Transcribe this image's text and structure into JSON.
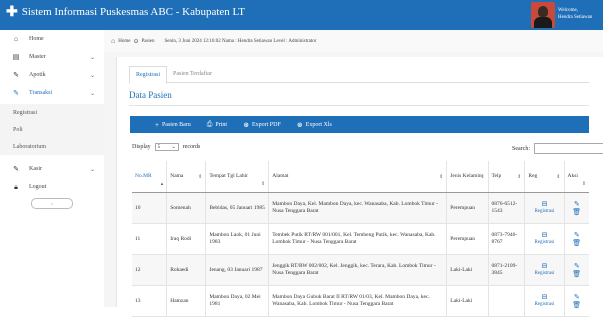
{
  "header": {
    "app_title": "Sistem Informasi Puskesmas ABC - Kabupaten LT",
    "welcome": "Welcome,",
    "user_name": "Hendra Setiawan"
  },
  "sidebar": {
    "items": [
      {
        "label": "Home",
        "icon": "home-icon"
      },
      {
        "label": "Master",
        "icon": "table-icon"
      },
      {
        "label": "Apotik",
        "icon": "edit-icon"
      },
      {
        "label": "Transaksi",
        "icon": "edit-icon"
      },
      {
        "label": "Kasir",
        "icon": "edit-icon"
      },
      {
        "label": "Logout",
        "icon": "lock-icon"
      }
    ],
    "sub_items": [
      "Registrasi",
      "Poli",
      "Laboratorium"
    ],
    "collapse_label": "‹"
  },
  "breadcrumb": {
    "home": "Home",
    "current": "Pasien",
    "status": "Senin, 3 Juni 2024 12:16:02 Nama : Hendra Setiawan Level : Administrator"
  },
  "tabs": [
    {
      "label": "Registrasi"
    },
    {
      "label": "Pasien Terdaftar"
    }
  ],
  "page_title": "Data Pasien",
  "toolbar": {
    "new_label": "Pasien Baru",
    "print_label": "Print",
    "pdf_label": "Export PDF",
    "xls_label": "Export Xls"
  },
  "table_controls": {
    "display_label": "Display",
    "display_value": "5",
    "records_label": "records",
    "search_label": "Search:"
  },
  "table": {
    "columns": [
      "No.MR",
      "Nama",
      "Tempat Tgl Lahir",
      "Alamat",
      "Jenis Kelamin",
      "Telp",
      "Reg",
      "Aksi"
    ],
    "rows": [
      {
        "no": "10",
        "nama": "Somenah",
        "ttl": "Bebidas, 05 Januari 1985",
        "alamat": "Mambon Daya, Kel. Mambon Daya, kec. Wanasaba, Kab. Lombok Timur - Nusa Tenggara Barat",
        "jk": "Perempuan",
        "telp": "0876-6512-1543",
        "reg": "Registrasi"
      },
      {
        "no": "11",
        "nama": "Iraq Rodi",
        "ttl": "Mambon Laok, 01 Juni 1983",
        "alamat": "Tembek Putik RT/RW 001/001, Kel. Tembeng Putik, kec. Wanasaba, Kab. Lombok Timur - Nusa Tenggara Barat",
        "jk": "Perempuan",
        "telp": "0873-7946-8767",
        "reg": "Registrasi"
      },
      {
        "no": "12",
        "nama": "Rohaedi",
        "ttl": "Jenang, 03 Januari 1987",
        "alamat": "Jenggik RT/RW 002/002, Kel. Jenggik, kec. Terara, Kab. Lombok Timur - Nusa Tenggara Barat",
        "jk": "Laki-Laki",
        "telp": "0871-2109-3845",
        "reg": "Registrasi"
      },
      {
        "no": "13",
        "nama": "Hamzan",
        "ttl": "Mambon Daya, 02 Mei 1981",
        "alamat": "Mambon Daya Gubuk Barat II RT/RW 01/03, Kel. Mambon Daya, kec. Wanasaba, Kab. Lombok Timur - Nusa Tenggara Barat",
        "jk": "Laki-Laki",
        "telp": "",
        "reg": "Registrasi"
      }
    ]
  },
  "colors": {
    "primary": "#1f6fb8",
    "topbar": "#1f6fb8"
  }
}
